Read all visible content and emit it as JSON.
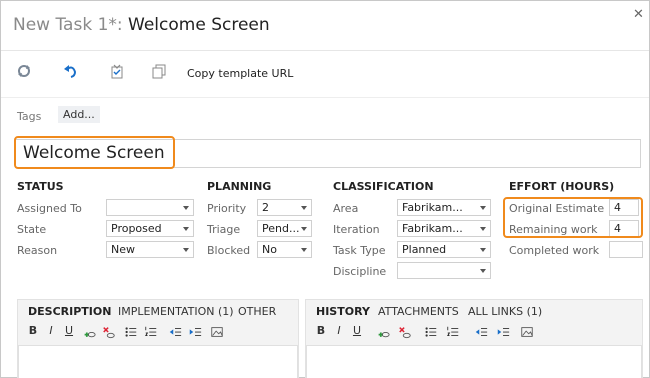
{
  "window": {
    "title_prefix": "New Task 1*: ",
    "title_name": "Welcome Screen"
  },
  "toolbar": {
    "icons": [
      "refresh-icon",
      "undo-icon",
      "revert-icon",
      "copy-icon"
    ],
    "copy_template_url": "Copy template URL"
  },
  "tags": {
    "label": "Tags",
    "add": "Add..."
  },
  "work_item": {
    "title": "Welcome Screen"
  },
  "status": {
    "header": "STATUS",
    "assigned_to": {
      "label": "Assigned To",
      "value": ""
    },
    "state": {
      "label": "State",
      "value": "Proposed"
    },
    "reason": {
      "label": "Reason",
      "value": "New"
    }
  },
  "planning": {
    "header": "PLANNING",
    "priority": {
      "label": "Priority",
      "value": "2"
    },
    "triage": {
      "label": "Triage",
      "value": "Pend..."
    },
    "blocked": {
      "label": "Blocked",
      "value": "No"
    }
  },
  "classification": {
    "header": "CLASSIFICATION",
    "area": {
      "label": "Area",
      "value": "Fabrikam..."
    },
    "iteration": {
      "label": "Iteration",
      "value": "Fabrikam..."
    },
    "task_type": {
      "label": "Task Type",
      "value": "Planned"
    },
    "discipline": {
      "label": "Discipline",
      "value": ""
    }
  },
  "effort": {
    "header": "EFFORT (HOURS)",
    "original_estimate": {
      "label": "Original Estimate",
      "value": "4"
    },
    "remaining_work": {
      "label": "Remaining work",
      "value": "4"
    },
    "completed_work": {
      "label": "Completed work",
      "value": ""
    }
  },
  "left_panel": {
    "tabs": [
      "DESCRIPTION",
      "IMPLEMENTATION (1)",
      "OTHER"
    ],
    "active_tab": "DESCRIPTION"
  },
  "right_panel": {
    "tabs": [
      "HISTORY",
      "ATTACHMENTS",
      "ALL LINKS (1)"
    ],
    "active_tab": "HISTORY"
  },
  "editor_toolbar": {
    "bold": "B",
    "italic": "I",
    "underline": "U"
  },
  "colors": {
    "highlight": "#f08a1c",
    "accent_blue": "#1a6fc9"
  }
}
